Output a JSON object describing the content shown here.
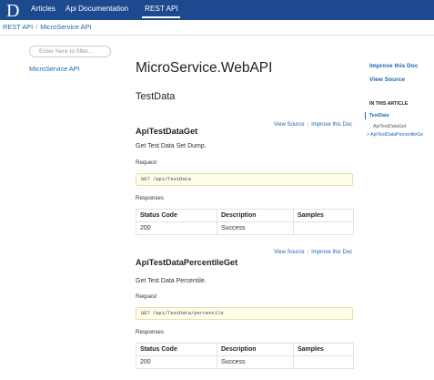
{
  "nav": {
    "logo": "D",
    "items": [
      "Articles",
      "Api Documentation",
      "REST API"
    ],
    "active_index": 2,
    "colors": {
      "bar": "#1d4a8e",
      "text": "#ffffff"
    }
  },
  "breadcrumb": {
    "items": [
      "REST API",
      "MicroService API"
    ]
  },
  "toc": {
    "filter_placeholder": "Enter here to filter...",
    "items": [
      "MicroService API"
    ]
  },
  "article": {
    "title": "MicroService.WebAPI",
    "section": "TestData",
    "operations": [
      {
        "name": "ApiTestDataGet",
        "view_source": "View Source",
        "separator": "|",
        "improve": "Improve this Doc",
        "description": "Get Test Data Set Dump.",
        "request_label": "Request",
        "request_code": "GET /api/TestData",
        "responses_label": "Responses",
        "table": {
          "headers": [
            "Status Code",
            "Description",
            "Samples"
          ],
          "rows": [
            [
              "200",
              "Success",
              ""
            ]
          ]
        }
      },
      {
        "name": "ApiTestDataPercentileGet",
        "view_source": "View Source",
        "separator": "|",
        "improve": "Improve this Doc",
        "description": "Get Test Data Percentile.",
        "request_label": "Request",
        "request_code": "GET /api/TestData/percentile",
        "responses_label": "Responses",
        "table": {
          "headers": [
            "Status Code",
            "Description",
            "Samples"
          ],
          "rows": [
            [
              "200",
              "Success",
              ""
            ]
          ]
        }
      }
    ]
  },
  "affix": {
    "improve": "Improve this Doc",
    "view_source": "View Source",
    "in_this_article": "IN THIS ARTICLE",
    "items": [
      "TestData",
      "ApiTestDataGet",
      "ApiTestDataPercentileGe"
    ],
    "expander": ">"
  },
  "icons": {
    "logo": "docfx-logo-icon"
  }
}
